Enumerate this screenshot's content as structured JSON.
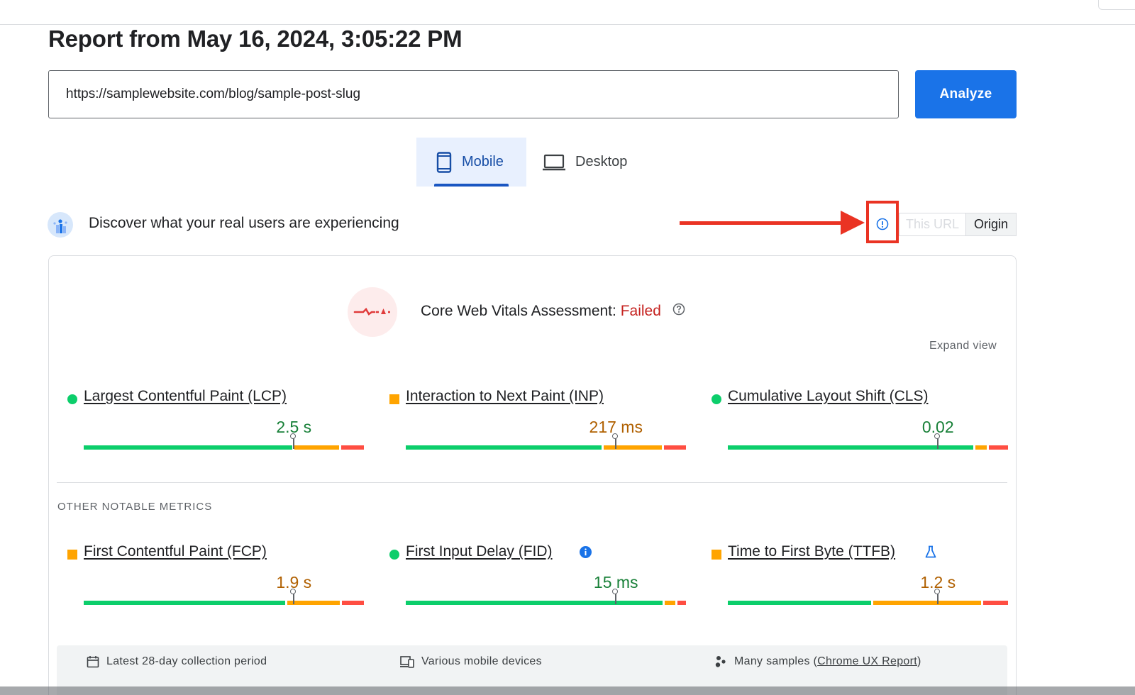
{
  "header": {
    "report_title": "Report from May 16, 2024, 3:05:22 PM"
  },
  "search": {
    "url_value": "https://samplewebsite.com/blog/sample-post-slug",
    "analyze_label": "Analyze"
  },
  "tabs": [
    {
      "label": "Mobile",
      "selected": true,
      "icon": "phone-icon"
    },
    {
      "label": "Desktop",
      "selected": false,
      "icon": "laptop-icon"
    }
  ],
  "field_data": {
    "title": "Discover what your real users are experiencing",
    "toggle": {
      "options": [
        "This URL",
        "Origin"
      ],
      "selected": "Origin",
      "this_url_disabled": true
    }
  },
  "cwv": {
    "label": "Core Web Vitals Assessment:",
    "status": "Failed",
    "expand_label": "Expand view"
  },
  "metrics": [
    {
      "name": "Largest Contentful Paint (LCP)",
      "value": "2.5 s",
      "rating": "good",
      "bar": {
        "good": 0.74,
        "average": 0.16,
        "poor": 0.08
      },
      "marker": 0.75
    },
    {
      "name": "Interaction to Next Paint (INP)",
      "value": "217 ms",
      "rating": "average",
      "bar": {
        "good": 0.71,
        "average": 0.21,
        "poor": 0.08
      },
      "marker": 0.75
    },
    {
      "name": "Cumulative Layout Shift (CLS)",
      "value": "0.02",
      "rating": "good",
      "bar": {
        "good": 0.89,
        "average": 0.04,
        "poor": 0.07
      },
      "marker": 0.75
    }
  ],
  "other": {
    "section_label": "OTHER NOTABLE METRICS",
    "metrics": [
      {
        "name": "First Contentful Paint (FCP)",
        "value": "1.9 s",
        "rating": "average",
        "bar": {
          "good": 0.73,
          "average": 0.19,
          "poor": 0.08
        },
        "marker": 0.75,
        "extra_icon": ""
      },
      {
        "name": "First Input Delay (FID)",
        "value": "15 ms",
        "rating": "good",
        "bar": {
          "good": 0.93,
          "average": 0.04,
          "poor": 0.03
        },
        "marker": 0.75,
        "extra_icon": "info-icon"
      },
      {
        "name": "Time to First Byte (TTFB)",
        "value": "1.2 s",
        "rating": "average",
        "bar": {
          "good": 0.52,
          "average": 0.39,
          "poor": 0.09
        },
        "marker": 0.75,
        "extra_icon": "flask-icon"
      }
    ]
  },
  "footer": {
    "collection_period": "Latest 28-day collection period",
    "devices": "Various mobile devices",
    "samples_prefix": "Many samples (",
    "samples_link": "Chrome UX Report",
    "samples_suffix": ")"
  },
  "colors": {
    "accent": "#1a73e8",
    "good": "#0cce6b",
    "average": "#ffa400",
    "poor": "#ff4e42",
    "failed_text": "#c5221f",
    "annotation": "#ea3323"
  }
}
